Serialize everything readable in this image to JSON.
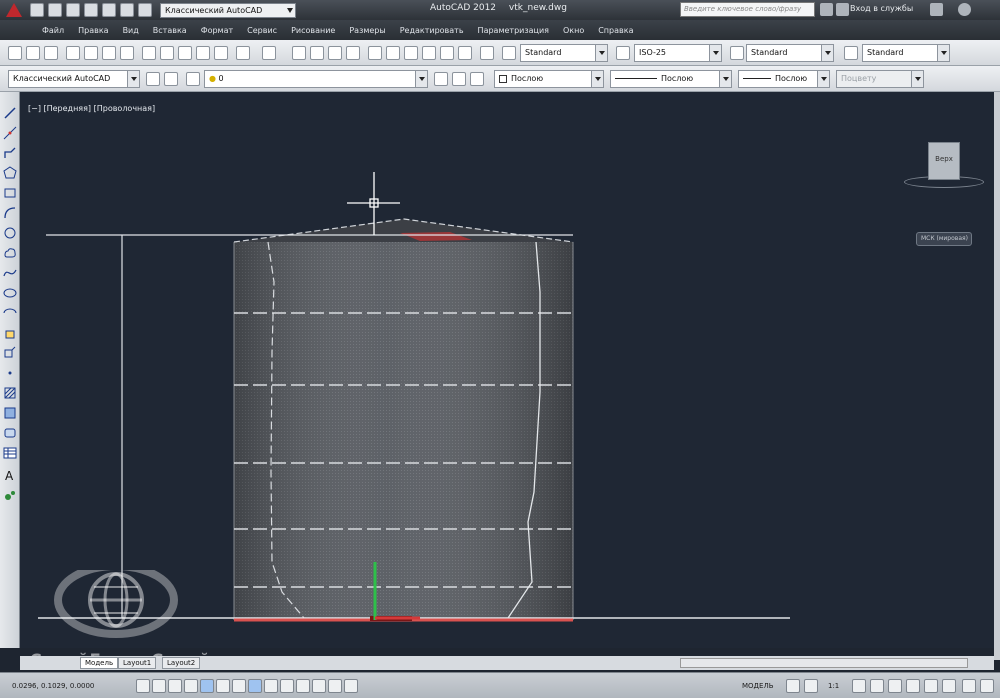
{
  "titlebar": {
    "workspace": "Классический AutoCAD",
    "app_title": "AutoCAD 2012",
    "file_name": "vtk_new.dwg",
    "search_placeholder": "Введите ключевое слово/фразу",
    "sign_in": "Вход в службы"
  },
  "menubar": {
    "items": [
      "Файл",
      "Правка",
      "Вид",
      "Вставка",
      "Формат",
      "Сервис",
      "Рисование",
      "Размеры",
      "Редактировать",
      "Параметризация",
      "Окно",
      "Справка"
    ]
  },
  "toolbar1": {
    "text_style": "Standard",
    "dim_style": "ISO-25",
    "table_style": "Standard",
    "mleader_style": "Standard"
  },
  "toolbar2": {
    "workspace": "Классический AutoCAD",
    "layer": "0",
    "color": "Послою",
    "linetype": "Послою",
    "lineweight": "Послою",
    "plotstyle": "Поцвету"
  },
  "viewport": {
    "label": "[−] [Передняя] [Проволочная]",
    "viewcube_face": "Верх",
    "wcs_label": "МСК (мировая)"
  },
  "tabs": [
    "Модель",
    "Layout1",
    "Layout2"
  ],
  "status": {
    "coords": "0.0296, 0.1029, 0.0000",
    "model": "МОДЕЛЬ",
    "scale": "1:1"
  },
  "watermark": {
    "text": "СтройГидроСтрой"
  },
  "colors": {
    "viewport_bg": "#1f2734",
    "tank_fill": "#5d6168",
    "accent_red": "#d43a3a",
    "ucs_green": "#2ec04a"
  }
}
